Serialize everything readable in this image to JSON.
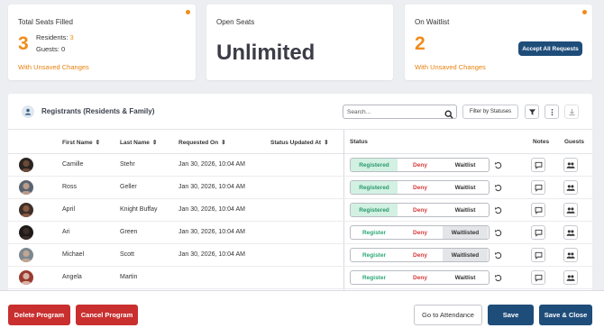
{
  "stats": {
    "seats_filled": {
      "title": "Total Seats Filled",
      "value": "3",
      "residents_label": "Residents:",
      "residents_value": "3",
      "guests_label": "Guests:",
      "guests_value": "0",
      "unsaved": "With Unsaved Changes"
    },
    "open_seats": {
      "title": "Open Seats",
      "value": "Unlimited"
    },
    "waitlist": {
      "title": "On Waitlist",
      "value": "2",
      "accept_label": "Accept All Requests",
      "unsaved": "With Unsaved Changes"
    }
  },
  "registrants": {
    "title": "Registrants (Residents & Family)",
    "search_placeholder": "Search...",
    "filter_label": "Filter by Statuses",
    "columns": {
      "first_name": "First Name",
      "last_name": "Last Name",
      "requested_on": "Requested On",
      "status_updated_at": "Status Updated At",
      "status": "Status",
      "notes": "Notes",
      "guests": "Guests"
    },
    "status_options": {
      "registered": "Registered",
      "register": "Register",
      "deny": "Deny",
      "waitlist": "Waitlist",
      "waitlisted": "Waitlisted"
    },
    "rows": [
      {
        "first": "Camille",
        "last": "Stehr",
        "requested": "Jan 30, 2026, 10:04 AM",
        "updated": "",
        "status": "registered"
      },
      {
        "first": "Ross",
        "last": "Geller",
        "requested": "Jan 30, 2026, 10:04 AM",
        "updated": "",
        "status": "registered"
      },
      {
        "first": "April",
        "last": "Knight Buffay",
        "requested": "Jan 30, 2026, 10:04 AM",
        "updated": "",
        "status": "registered"
      },
      {
        "first": "Ari",
        "last": "Green",
        "requested": "Jan 30, 2026, 10:04 AM",
        "updated": "",
        "status": "waitlisted"
      },
      {
        "first": "Michael",
        "last": "Scott",
        "requested": "Jan 30, 2026, 10:04 AM",
        "updated": "",
        "status": "waitlisted"
      },
      {
        "first": "Angela",
        "last": "Martin",
        "requested": "",
        "updated": "",
        "status": "none"
      }
    ]
  },
  "footer": {
    "delete_program": "Delete Program",
    "cancel_program": "Cancel Program",
    "go_to_attendance": "Go to Attendance",
    "save": "Save",
    "save_close": "Save & Close"
  },
  "colors": {
    "accent_orange": "#f08c1a",
    "navy": "#1f4d7a",
    "danger": "#c92f2f",
    "registered_green": "#2aa876"
  }
}
